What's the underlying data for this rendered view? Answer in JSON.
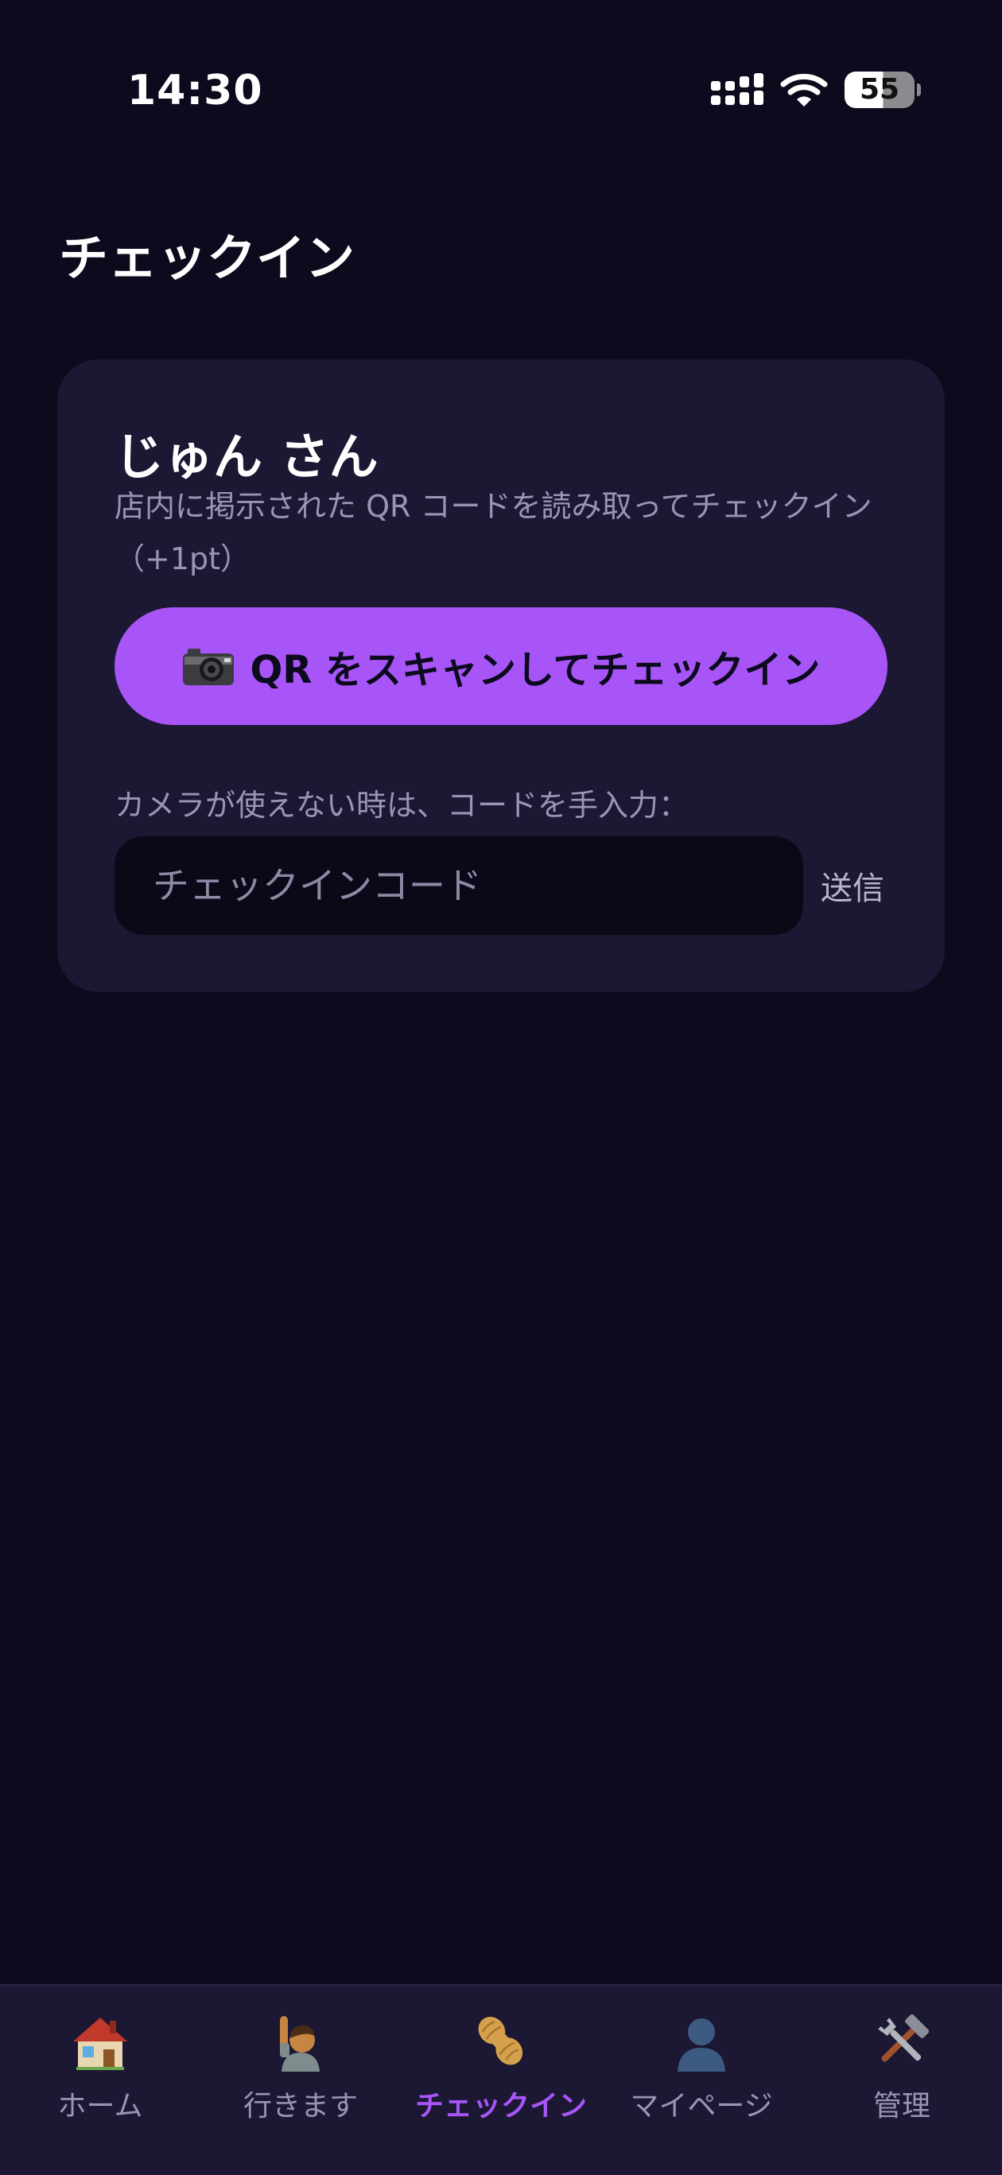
{
  "status_bar": {
    "time": "14:30",
    "battery_level": "55"
  },
  "page": {
    "title": "チェックイン"
  },
  "card": {
    "user_name": "じゅん さん",
    "instruction": "店内に掲示された QR コードを読み取ってチェックイン（+1pt）",
    "scan_button_label": "QR をスキャンしてチェックイン",
    "manual_label": "カメラが使えない時は、コードを手入力：",
    "code_input": {
      "value": "",
      "placeholder": "チェックインコード"
    },
    "send_label": "送信"
  },
  "bottom_nav": {
    "active": "checkin",
    "items": [
      {
        "id": "home",
        "label": "ホーム",
        "icon": "house-icon"
      },
      {
        "id": "going",
        "label": "行きます",
        "icon": "raising-hand-icon"
      },
      {
        "id": "checkin",
        "label": "チェックイン",
        "icon": "peanut-icon"
      },
      {
        "id": "mypage",
        "label": "マイページ",
        "icon": "person-icon"
      },
      {
        "id": "admin",
        "label": "管理",
        "icon": "tools-icon"
      }
    ]
  },
  "colors": {
    "background": "#0c0a1d",
    "card": "#1c1733",
    "accent": "#a855f7",
    "muted_text": "#9a95b5",
    "input_bg": "#0b0918"
  }
}
